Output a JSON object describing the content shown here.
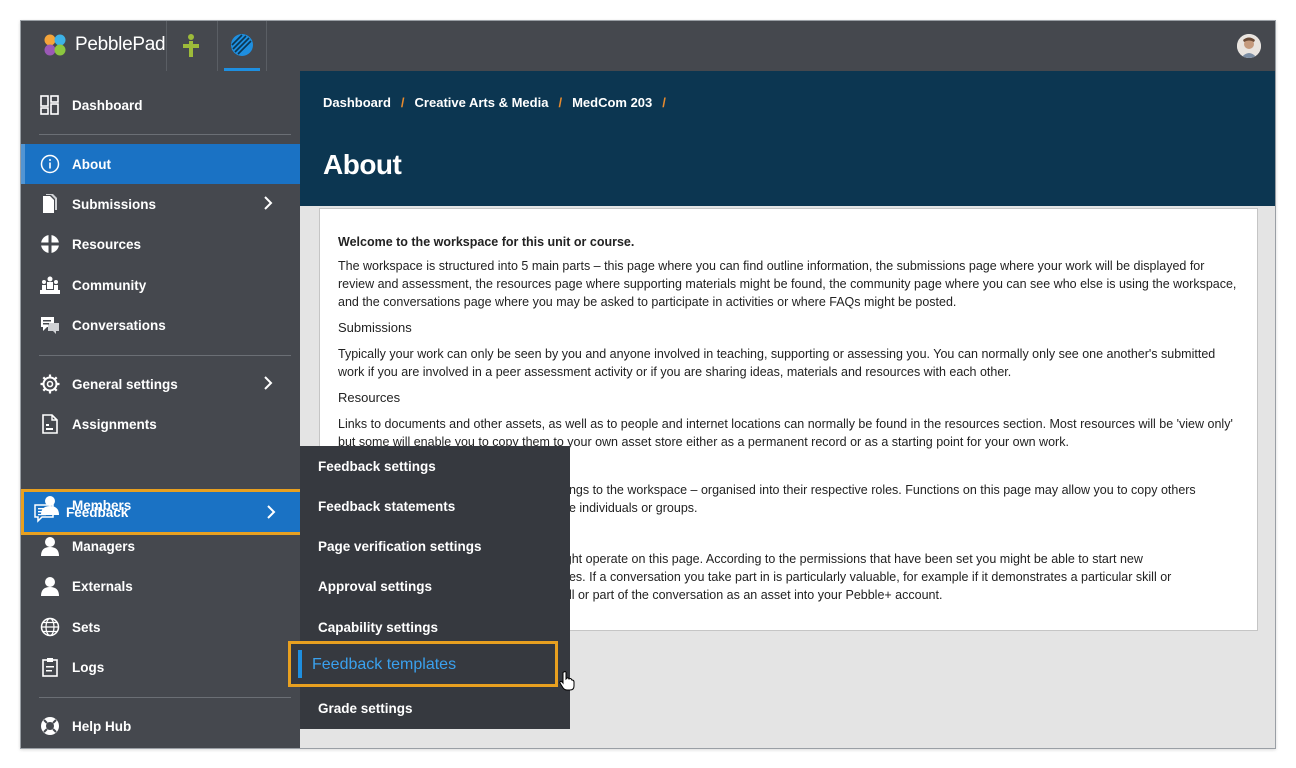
{
  "app": {
    "brand": "PebblePad"
  },
  "sidebar": {
    "items": [
      {
        "label": "Dashboard"
      },
      {
        "label": "About"
      },
      {
        "label": "Submissions"
      },
      {
        "label": "Resources"
      },
      {
        "label": "Community"
      },
      {
        "label": "Conversations"
      },
      {
        "label": "General settings"
      },
      {
        "label": "Assignments"
      },
      {
        "label": "Feedback"
      },
      {
        "label": "Members"
      },
      {
        "label": "Managers"
      },
      {
        "label": "Externals"
      },
      {
        "label": "Sets"
      },
      {
        "label": "Logs"
      },
      {
        "label": "Help Hub"
      }
    ]
  },
  "breadcrumb": [
    "Dashboard",
    "Creative Arts & Media",
    "MedCom 203"
  ],
  "breadcrumb_sep": "/",
  "page": {
    "title": "About"
  },
  "content": {
    "intro": "Welcome to the workspace for this unit or course.",
    "para1": "The workspace is structured into 5 main parts – this page where you can find outline information, the submissions page where your work will be displayed for review and assessment, the resources page where supporting materials might be found, the community page where you can see who else is using the workspace, and the conversations page where you may be asked to participate in activities or where FAQs might be posted.",
    "h_submissions": "Submissions",
    "para_submissions": "Typically your work can only be seen by you and anyone involved in teaching, supporting or assessing you. You can normally only see one another's submitted work if you are involved in a peer assessment activity or if you are sharing ideas, materials and resources with each other.",
    "h_resources": "Resources",
    "para_resources": "Links to documents and other assets, as well as to people and internet locations can normally be found in the resources section. Most resources will be 'view only' but some will enable you to copy them to your own asset store either as a permanent record or as a starting point for your own work.",
    "para_community_1": "ongs to the workspace – organised into their respective roles. Functions on this page may allow you to copy others",
    "para_community_2": "ge individuals or groups.",
    "para_conv_1": "ight operate on this page. According to the permissions that have been set you might be able to start new",
    "para_conv_2": "nes. If a conversation you take part in is particularly valuable, for example if it demonstrates a particular skill or",
    "para_conv_3": "all or part of the conversation as an asset into your Pebble+ account."
  },
  "flyout": {
    "items": [
      {
        "label": "Feedback settings"
      },
      {
        "label": "Feedback statements"
      },
      {
        "label": "Page verification settings"
      },
      {
        "label": "Approval settings"
      },
      {
        "label": "Capability settings"
      },
      {
        "label": "Feedback templates"
      },
      {
        "label": "Grade settings"
      }
    ]
  },
  "colors": {
    "sidebar": "#45484e",
    "active": "#1a72c4",
    "header": "#0c3651",
    "highlight": "#e8a020",
    "crumb_sep": "#e88b2e"
  },
  "icons": [
    "dashboard-icon",
    "info-icon",
    "document-icon",
    "resources-icon",
    "community-icon",
    "chat-icon",
    "gear-icon",
    "assignment-icon",
    "feedback-icon",
    "person-icon",
    "globe-icon",
    "clipboard-icon",
    "help-icon",
    "chevron-right-icon"
  ]
}
